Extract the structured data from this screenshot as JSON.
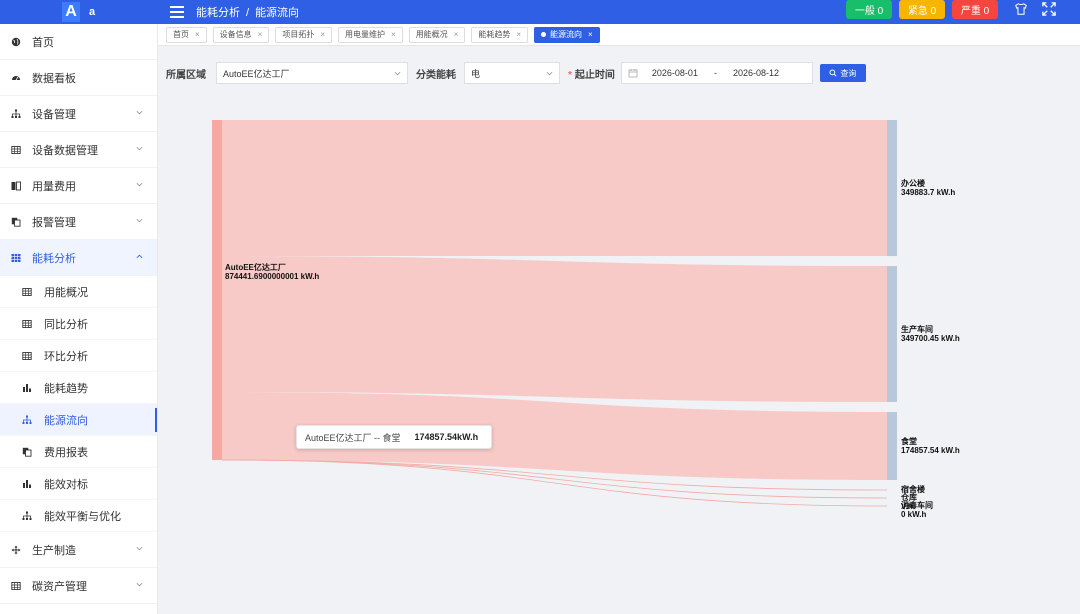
{
  "app": {
    "logo_letter": "A",
    "user": "a"
  },
  "breadcrumb": [
    "能耗分析",
    "能源流向"
  ],
  "alarms": [
    {
      "label": "一般 0",
      "color": "#19be6b"
    },
    {
      "label": "紧急 0",
      "color": "#f7b500"
    },
    {
      "label": "严重 0",
      "color": "#f5453f"
    }
  ],
  "sidebar": {
    "items": [
      {
        "label": "首页",
        "icon": "globe-icon",
        "has_chevron": false
      },
      {
        "label": "数据看板",
        "icon": "dashboard-icon",
        "has_chevron": false
      },
      {
        "label": "设备管理",
        "icon": "sitemap-icon",
        "has_chevron": true
      },
      {
        "label": "设备数据管理",
        "icon": "table-icon",
        "has_chevron": true
      },
      {
        "label": "用量费用",
        "icon": "columns-icon",
        "has_chevron": true
      },
      {
        "label": "报警管理",
        "icon": "copy-icon",
        "has_chevron": true
      }
    ],
    "open_group": {
      "label": "能耗分析",
      "icon": "grid-icon",
      "children": [
        {
          "label": "用能概况",
          "icon": "table-icon"
        },
        {
          "label": "同比分析",
          "icon": "table-icon"
        },
        {
          "label": "环比分析",
          "icon": "table-icon"
        },
        {
          "label": "能耗趋势",
          "icon": "bar-chart-icon"
        },
        {
          "label": "能源流向",
          "icon": "sitemap-icon"
        },
        {
          "label": "费用报表",
          "icon": "copy-icon"
        },
        {
          "label": "能效对标",
          "icon": "bar-chart-icon"
        },
        {
          "label": "能效平衡与优化",
          "icon": "sitemap-icon"
        }
      ]
    },
    "after_items": [
      {
        "label": "生产制造",
        "icon": "move-icon",
        "has_chevron": true
      },
      {
        "label": "碳资产管理",
        "icon": "table-icon",
        "has_chevron": true
      }
    ]
  },
  "tabs": [
    {
      "label": "首页",
      "active": false
    },
    {
      "label": "设备信息",
      "active": false
    },
    {
      "label": "项目拓扑",
      "active": false
    },
    {
      "label": "用电量维护",
      "active": false
    },
    {
      "label": "用能概况",
      "active": false
    },
    {
      "label": "能耗趋势",
      "active": false
    },
    {
      "label": "能源流向",
      "active": true
    }
  ],
  "filters": {
    "area_label": "所属区域",
    "area_value": "AutoEE亿达工厂",
    "category_label": "分类能耗",
    "category_value": "电",
    "time_label": "起止时间",
    "start_date": "2026-08-01",
    "date_sep": "-",
    "end_date": "2026-08-12",
    "query_label": "查询"
  },
  "chart_data": {
    "type": "sankey",
    "source": {
      "name": "AutoEE亿达工厂",
      "value_label": "874441.6900000001 kW.h",
      "value": 874441.69
    },
    "targets": [
      {
        "name": "办公楼",
        "value_label": "349883.7 kW.h",
        "value": 349883.7
      },
      {
        "name": "生产车间",
        "value_label": "349700.45 kW.h",
        "value": 349700.45
      },
      {
        "name": "食堂",
        "value_label": "174857.54 kW.h",
        "value": 174857.54
      },
      {
        "name": "宿舍楼",
        "value_label": "",
        "value": 0
      },
      {
        "name": "仓库",
        "value_label": "V.h",
        "value": 0
      },
      {
        "name": "消毒车间",
        "value_label": "0 kW.h",
        "value": 0
      }
    ],
    "colors": {
      "source_node": "#f7a8a0",
      "link": "#f7c7c4",
      "target_node": "#b8c8db"
    },
    "tooltip": {
      "text": "AutoEE亿达工厂 -- 食堂",
      "value": "174857.54kW.h"
    }
  }
}
